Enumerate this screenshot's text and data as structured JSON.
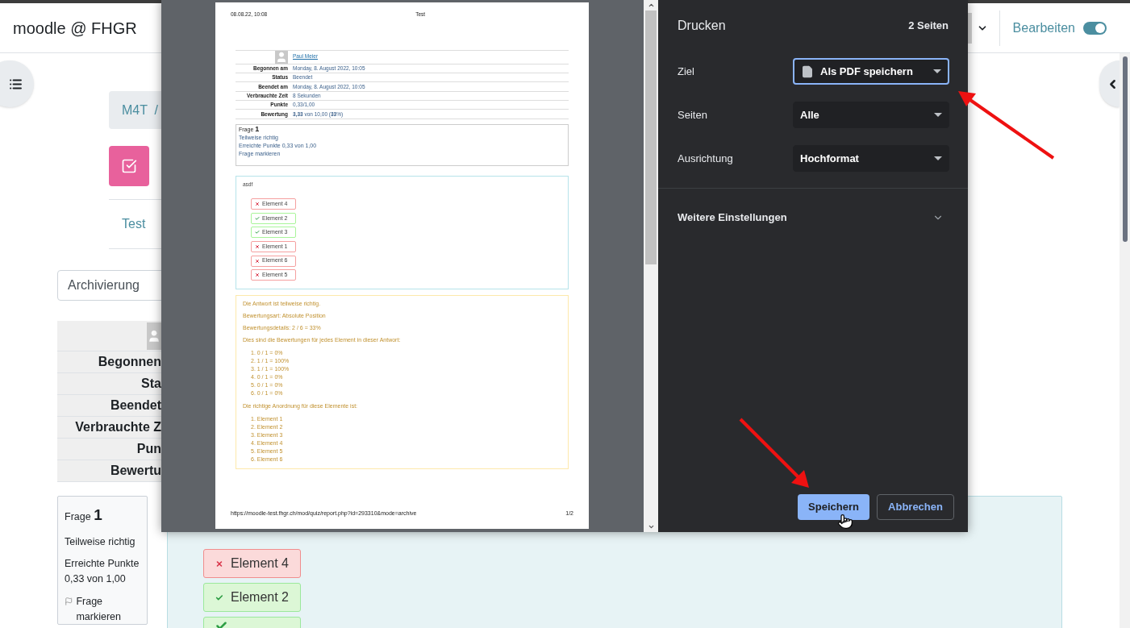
{
  "header": {
    "site_name": "moodle @ FHGR",
    "edit_mode": {
      "label": "Bearbeiten",
      "on": true
    }
  },
  "breadcrumb": "M4T /",
  "nav_link": "Test",
  "archive_select": {
    "value": "Archivierung"
  },
  "summary_labels": [
    "Begonnen",
    "Sta",
    "Beendet",
    "Verbrauchte Z",
    "Pun",
    "Bewertu"
  ],
  "question_info": {
    "title": "Frage",
    "number": "1",
    "state": "Teilweise richtig",
    "points": "Erreichte Punkte 0,33 von 1,00",
    "flag": "Frage markieren"
  },
  "answer_items": [
    {
      "label": "Element 4",
      "correct": false
    },
    {
      "label": "Element 2",
      "correct": true
    },
    {
      "correct": true
    }
  ],
  "print_dialog": {
    "title": "Drucken",
    "page_count": "2 Seiten",
    "settings": [
      {
        "label": "Ziel",
        "value": "Als PDF speichern",
        "focused": true,
        "kind": "destination"
      },
      {
        "label": "Seiten",
        "value": "Alle",
        "focused": false,
        "kind": "plain"
      },
      {
        "label": "Ausrichtung",
        "value": "Hochformat",
        "focused": false,
        "kind": "plain"
      }
    ],
    "more": "Weitere Einstellungen",
    "buttons": [
      {
        "label": "Speichern",
        "kind": "primary"
      },
      {
        "label": "Abbrechen",
        "kind": "secondary"
      }
    ]
  },
  "preview": {
    "date": "08.08.22, 10:08",
    "title": "Test",
    "user": "Paul Meier",
    "rows": [
      {
        "label": "Begonnen am",
        "value": "Monday, 8. August 2022, 10:05"
      },
      {
        "label": "Status",
        "value": "Beendet"
      },
      {
        "label": "Beendet am",
        "value": "Monday, 8. August 2022, 10:05"
      },
      {
        "label": "Verbrauchte Zeit",
        "value": "8 Sekunden"
      },
      {
        "label": "Punkte",
        "value": "0,33/1,00"
      },
      {
        "label": "Bewertung",
        "value": "**3,33** von 10,00 (**33**%)"
      }
    ],
    "question": {
      "title": "Frage",
      "number": "1",
      "state": "Teilweise richtig",
      "points": "Erreichte Punkte 0,33 von 1,00",
      "flag": "Frage markieren"
    },
    "answer_text": "asdf",
    "items": [
      {
        "label": "Element 4",
        "correct": false
      },
      {
        "label": "Element 2",
        "correct": true
      },
      {
        "label": "Element 3",
        "correct": true
      },
      {
        "label": "Element 1",
        "correct": false
      },
      {
        "label": "Element 6",
        "correct": false
      },
      {
        "label": "Element 5",
        "correct": false
      }
    ],
    "feedback": [
      "Die Antwort ist teilweise richtig.",
      "Bewertungsart: Absolute Position",
      "Bewertungsdetails: 2 / 6 = 33%",
      "Dies sind die Bewertungen für jedes Element in dieser Antwort:"
    ],
    "scores": [
      "1. 0 / 1 = 0%",
      "2. 1 / 1 = 100%",
      "3. 1 / 1 = 100%",
      "4. 0 / 1 = 0%",
      "5. 0 / 1 = 0%",
      "6. 0 / 1 = 0%"
    ],
    "order_title": "Die richtige Anordnung für diese Elemente ist:",
    "order": [
      "1. Element 1",
      "2. Element 2",
      "3. Element 3",
      "4. Element 4",
      "5. Element 5",
      "6. Element 6"
    ],
    "footer_url": "https://moodle-test.fhgr.ch/mod/quiz/report.php?id=293310&mode=archive",
    "page_number": "1/2"
  }
}
